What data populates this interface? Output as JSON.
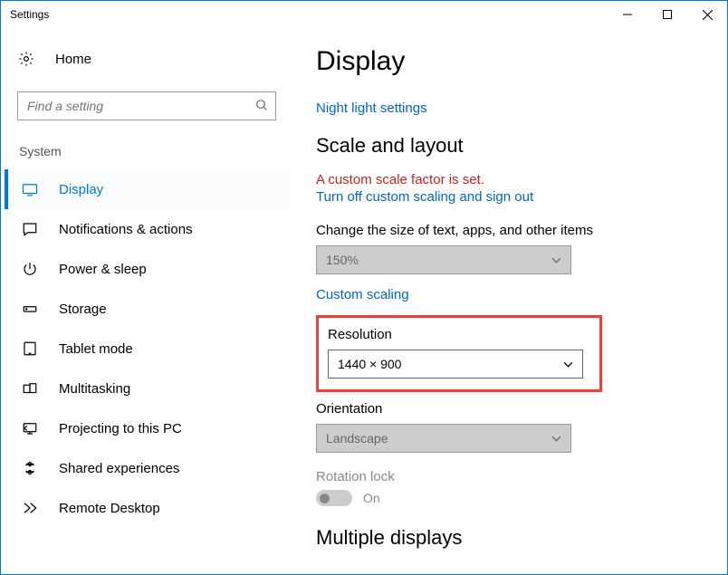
{
  "window": {
    "title": "Settings"
  },
  "home_label": "Home",
  "search": {
    "placeholder": "Find a setting"
  },
  "sidebar": {
    "group_title": "System",
    "items": [
      {
        "label": "Display"
      },
      {
        "label": "Notifications & actions"
      },
      {
        "label": "Power & sleep"
      },
      {
        "label": "Storage"
      },
      {
        "label": "Tablet mode"
      },
      {
        "label": "Multitasking"
      },
      {
        "label": "Projecting to this PC"
      },
      {
        "label": "Shared experiences"
      },
      {
        "label": "Remote Desktop"
      }
    ]
  },
  "main": {
    "title": "Display",
    "night_light_link": "Night light settings",
    "scale_heading": "Scale and layout",
    "warn_text": "A custom scale factor is set.",
    "turn_off_link": "Turn off custom scaling and sign out",
    "change_size_label": "Change the size of text, apps, and other items",
    "scale_value": "150%",
    "custom_scaling_link": "Custom scaling",
    "resolution_label": "Resolution",
    "resolution_value": "1440 × 900",
    "orientation_label": "Orientation",
    "orientation_value": "Landscape",
    "rotation_lock_label": "Rotation lock",
    "rotation_lock_value": "On",
    "multi_heading": "Multiple displays"
  }
}
